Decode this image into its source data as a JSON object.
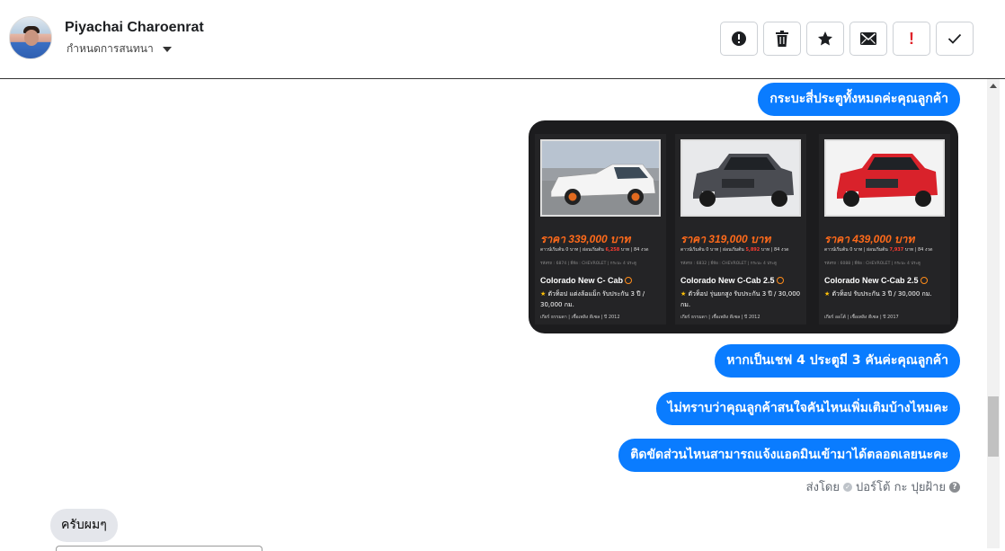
{
  "header": {
    "contact_name": "Piyachai Charoenrat",
    "assign_label": "กำหนดการสนทนา",
    "actions": [
      {
        "name": "report-spam-button",
        "icon": "alert-circle-icon"
      },
      {
        "name": "delete-button",
        "icon": "trash-icon"
      },
      {
        "name": "star-button",
        "icon": "star-icon"
      },
      {
        "name": "mark-unread-button",
        "icon": "envelope-icon"
      },
      {
        "name": "mark-important-button",
        "icon": "exclamation-icon"
      },
      {
        "name": "mark-done-button",
        "icon": "checkmark-icon"
      }
    ]
  },
  "messages": {
    "out1": "กระบะสี่ประตูทั้งหมดค่ะคุณลูกค้า",
    "out2": "หากเป็นเชฟ 4 ประตูมี 3 คันค่ะคุณลูกค้า",
    "out3": "ไม่ทราบว่าคุณลูกค้าสนใจคันไหนเพิ่มเติมบ้างไหมคะ",
    "out4": "ติดขัดส่วนไหนสามารถแจ้งแอดมินเข้ามาได้ตลอดเลยนะคะ",
    "sent_by_prefix": "ส่งโดย",
    "sent_by_name": "ปอร์โต้ กะ ปุยฝ้าย",
    "in1": "ครับผมๆ"
  },
  "cars": [
    {
      "price": "ราคา 339,000 บาท",
      "fin_a": "ดาวน์เริ่มต้น 0 บาท | ผ่อนเริ่มต้น ",
      "fin_red": "6,258",
      "fin_b": " บาท | 84 งวด",
      "category": "รหัสรถ : 6874 | ยี่ห้อ : CHEVROLET | กระบะ 4 ประตู",
      "model": "Colorado New C- Cab",
      "desc": "ตัวท็อป แต่งล้อแม็ก รับประกัน 3 ปี / 30,000 กม.",
      "meta": "เกียร์ ธรรมดา | เชื้อเพลิง ดีเซล | ปี 2012",
      "color": "#f2f2f2"
    },
    {
      "price": "ราคา 319,000 บาท",
      "fin_a": "ดาวน์เริ่มต้น 0 บาท | ผ่อนเริ่มต้น ",
      "fin_red": "5,892",
      "fin_b": " บาท | 84 งวด",
      "category": "รหัสรถ : 6832 | ยี่ห้อ : CHEVROLET | กระบะ 4 ประตู",
      "model": "Colorado New C-Cab 2.5",
      "desc": "ตัวท็อป รุ่นยกสูง รับประกัน 3 ปี / 30,000 กม.",
      "meta": "เกียร์ ธรรมดา | เชื้อเพลิง ดีเซล | ปี 2012",
      "color": "#4a4c52"
    },
    {
      "price": "ราคา 439,000 บาท",
      "fin_a": "ดาวน์เริ่มต้น 0 บาท | ผ่อนเริ่มต้น ",
      "fin_red": "7,937",
      "fin_b": " บาท | 84 งวด",
      "category": "รหัสรถ : 6088 | ยี่ห้อ : CHEVROLET | กระบะ 4 ประตู",
      "model": "Colorado New C-Cab 2.5",
      "desc": "ตัวท็อป รับประกัน 3 ปี / 30,000 กม.",
      "meta": "เกียร์ ออโต้ | เชื้อเพลิง ดีเซล | ปี 2017",
      "color": "#d9222b"
    }
  ]
}
